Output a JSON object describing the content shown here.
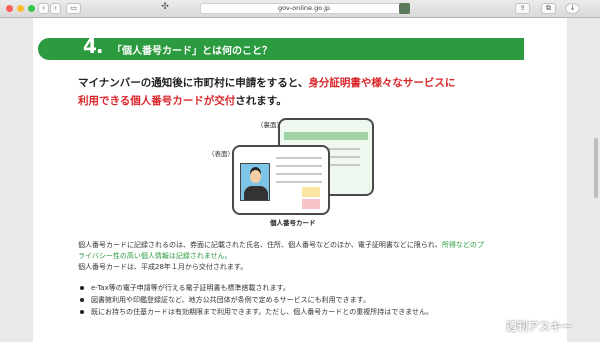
{
  "browser": {
    "url": "gov-online.go.jp",
    "colors": {
      "close": "#fc5f57",
      "minimize": "#fdbc2e",
      "zoom": "#34c749"
    }
  },
  "section": {
    "number": "4.",
    "title": "「個人番号カード」とは何のこと？",
    "accent_color": "#2c9a3e"
  },
  "lead": {
    "line1_black": "マイナンバーの通知後に市町村に申請をすると、",
    "line1_red": "身分証明書や様々なサービスに",
    "line2_red": "利用できる個人番号カードが交付",
    "line2_black": "されます。"
  },
  "illustration": {
    "back_label": "（裏面）",
    "front_label": "（表面）",
    "caption": "個人番号カード"
  },
  "body": {
    "p1a": "個人番号カードに記録されるのは、券面に記載された氏名、住所、個人番号などのほか、電子証明書などに限られ、",
    "p1b_green": "所得などのプ",
    "p2_green": "ライバシー性の高い個人情報は記録されません。",
    "p3": "個人番号カードは、平成28年１月から交付されます。"
  },
  "bullets": [
    "e-Tax等の電子申請等が行える電子証明書も標準搭載されます。",
    "図書館利用や印鑑登録証など、地方公共団体が条例で定めるサービスにも利用できます。",
    "既にお持ちの住基カードは有効期限まで利用できます。ただし、個人番号カードとの重複所持はできません。"
  ],
  "watermark": "週刊アスキー"
}
